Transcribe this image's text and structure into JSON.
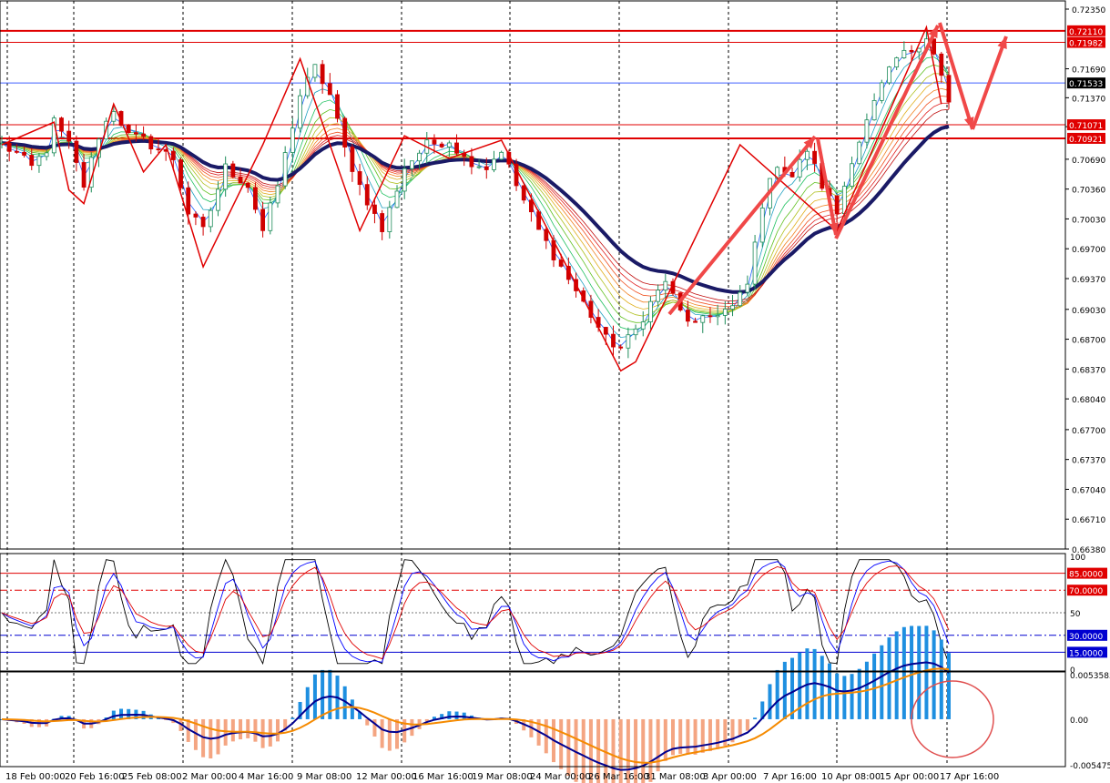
{
  "chart_data": [
    {
      "type": "candlestick",
      "panel": "price",
      "y_axis_ticks": [
        "0.72350",
        "0.71690",
        "0.71370",
        "0.71050",
        "0.70690",
        "0.70360",
        "0.70030",
        "0.69700",
        "0.69370",
        "0.69030",
        "0.68700",
        "0.68370",
        "0.68040",
        "0.67700",
        "0.67370",
        "0.67040",
        "0.66710",
        "0.66380"
      ],
      "ylim": [
        0.6638,
        0.7235
      ],
      "x_axis_ticks": [
        "18 Feb 00:00",
        "20 Feb 16:00",
        "25 Feb 08:00",
        "2 Mar 00:00",
        "4 Mar 16:00",
        "9 Mar 08:00",
        "12 Mar 00:00",
        "16 Mar 16:00",
        "19 Mar 08:00",
        "24 Mar 00:00",
        "26 Mar 16:00",
        "31 Mar 08:00",
        "3 Apr 00:00",
        "7 Apr 16:00",
        "10 Apr 08:00",
        "15 Apr 00:00",
        "17 Apr 16:00"
      ],
      "price_tags": [
        {
          "label": "0.72110",
          "value": 0.7211,
          "color": "#e00000"
        },
        {
          "label": "0.71982",
          "value": 0.71982,
          "color": "#e00000"
        },
        {
          "label": "0.71533",
          "value": 0.71533,
          "color": "#000000"
        },
        {
          "label": "0.71071",
          "value": 0.71071,
          "color": "#e00000"
        },
        {
          "label": "0.70921",
          "value": 0.70921,
          "color": "#e00000"
        }
      ],
      "horizontal_lines": [
        0.7211,
        0.71982,
        0.71533,
        0.71071,
        0.70921
      ],
      "close_series_anchors": [
        [
          0,
          0.7085
        ],
        [
          2,
          0.7075
        ],
        [
          4,
          0.706
        ],
        [
          6,
          0.708
        ],
        [
          7,
          0.711
        ],
        [
          9,
          0.7085
        ],
        [
          11,
          0.704
        ],
        [
          13,
          0.7095
        ],
        [
          15,
          0.7125
        ],
        [
          17,
          0.7095
        ],
        [
          19,
          0.709
        ],
        [
          21,
          0.708
        ],
        [
          23,
          0.707
        ],
        [
          25,
          0.701
        ],
        [
          27,
          0.699
        ],
        [
          30,
          0.706
        ],
        [
          33,
          0.704
        ],
        [
          35,
          0.699
        ],
        [
          37,
          0.704
        ],
        [
          40,
          0.714
        ],
        [
          42,
          0.717
        ],
        [
          44,
          0.714
        ],
        [
          46,
          0.708
        ],
        [
          48,
          0.704
        ],
        [
          51,
          0.699
        ],
        [
          54,
          0.706
        ],
        [
          57,
          0.7085
        ],
        [
          60,
          0.709
        ],
        [
          62,
          0.707
        ],
        [
          65,
          0.706
        ],
        [
          67,
          0.708
        ],
        [
          69,
          0.704
        ],
        [
          72,
          0.699
        ],
        [
          75,
          0.695
        ],
        [
          78,
          0.691
        ],
        [
          81,
          0.687
        ],
        [
          83,
          0.686
        ],
        [
          85,
          0.688
        ],
        [
          87,
          0.691
        ],
        [
          89,
          0.6935
        ],
        [
          91,
          0.69
        ],
        [
          93,
          0.6885
        ],
        [
          96,
          0.69
        ],
        [
          98,
          0.6905
        ],
        [
          100,
          0.693
        ],
        [
          102,
          0.702
        ],
        [
          104,
          0.7065
        ],
        [
          106,
          0.705
        ],
        [
          108,
          0.708
        ],
        [
          110,
          0.704
        ],
        [
          112,
          0.701
        ],
        [
          114,
          0.707
        ],
        [
          116,
          0.711
        ],
        [
          118,
          0.715
        ],
        [
          120,
          0.718
        ],
        [
          122,
          0.719
        ],
        [
          124,
          0.7205
        ],
        [
          125,
          0.7185
        ],
        [
          126,
          0.716
        ],
        [
          127,
          0.713
        ]
      ],
      "n_bars": 128
    },
    {
      "type": "line",
      "panel": "oscillator",
      "ylim": [
        0,
        100
      ],
      "y_axis_ticks": [
        "100",
        "50",
        "0"
      ],
      "levels": [
        {
          "label": "85.0000",
          "value": 85,
          "color": "#e00000",
          "style": "solid"
        },
        {
          "label": "70.0000",
          "value": 70,
          "color": "#e00000",
          "style": "dashdot"
        },
        {
          "label": "30.0000",
          "value": 30,
          "color": "#0000d0",
          "style": "dashdot"
        },
        {
          "label": "15.0000",
          "value": 15,
          "color": "#0000d0",
          "style": "solid"
        }
      ],
      "series": [
        {
          "color": "#000000"
        },
        {
          "color": "#0000ff"
        },
        {
          "color": "#e00000"
        }
      ]
    },
    {
      "type": "histogram",
      "panel": "macd",
      "ylim": [
        -0.005475,
        0.005358
      ],
      "y_axis_ticks": [
        "0.0053585",
        "0.00",
        "-0.005475"
      ],
      "series": [
        {
          "color": "#1e8fe0"
        },
        {
          "color": "#f4a582"
        },
        {
          "color": "#000090"
        },
        {
          "color": "#f58a00"
        }
      ]
    }
  ],
  "colors": {
    "bull": "#1e8c5a",
    "bear": "#d00000",
    "arrow": "#f04848",
    "zigzag": "#e00000",
    "base_ma": "#1a1a66",
    "annotation_circle": "#e05050"
  }
}
